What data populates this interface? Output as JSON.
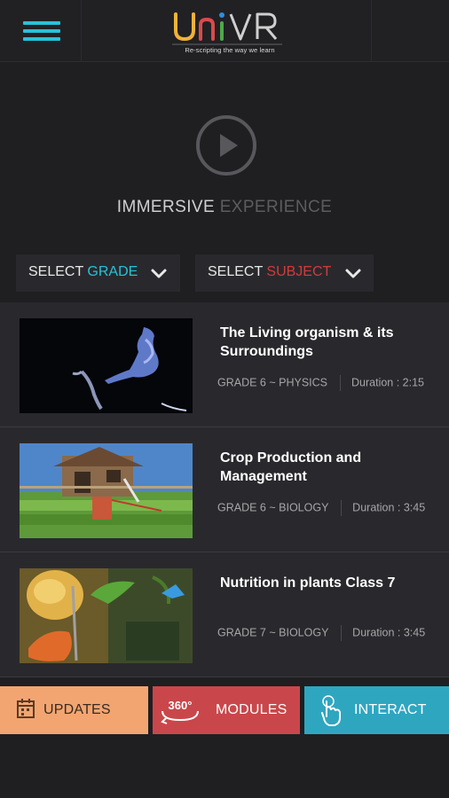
{
  "header": {
    "menu_icon": "hamburger-icon",
    "logo_text": "UniVR",
    "tagline": "Re-scripting the way we learn",
    "accent": "#27c2d8"
  },
  "hero": {
    "play_icon": "play-icon",
    "title_word1": "IMMERSIVE",
    "title_word2": "EXPERIENCE"
  },
  "filters": {
    "grade": {
      "prefix": "SELECT",
      "highlight": "GRADE",
      "color": "#27c2d8"
    },
    "subject": {
      "prefix": "SELECT",
      "highlight": "SUBJECT",
      "color": "#d23b3b"
    }
  },
  "videos": [
    {
      "title": "The Living organism & its Surroundings",
      "grade": "GRADE 6",
      "subject": "~ PHYSICS",
      "duration": "Duration : 2:15",
      "thumb": "deer-scene"
    },
    {
      "title": "Crop Production and Management",
      "grade": "GRADE 6",
      "subject": "~ BIOLOGY",
      "duration": "Duration : 3:45",
      "thumb": "farm-scene"
    },
    {
      "title": "Nutrition in plants Class 7",
      "grade": "GRADE 7",
      "subject": "~ BIOLOGY",
      "duration": "Duration : 3:45",
      "thumb": "plant-scene"
    }
  ],
  "tabs": [
    {
      "label": "UPDATES",
      "icon": "calendar-icon",
      "color": "#f2a571"
    },
    {
      "label": "MODULES",
      "icon": "360-icon",
      "icon_text": "360°",
      "color": "#c9474b"
    },
    {
      "label": "INTERACT",
      "icon": "touch-hand-icon",
      "color": "#2fa6c0"
    }
  ]
}
